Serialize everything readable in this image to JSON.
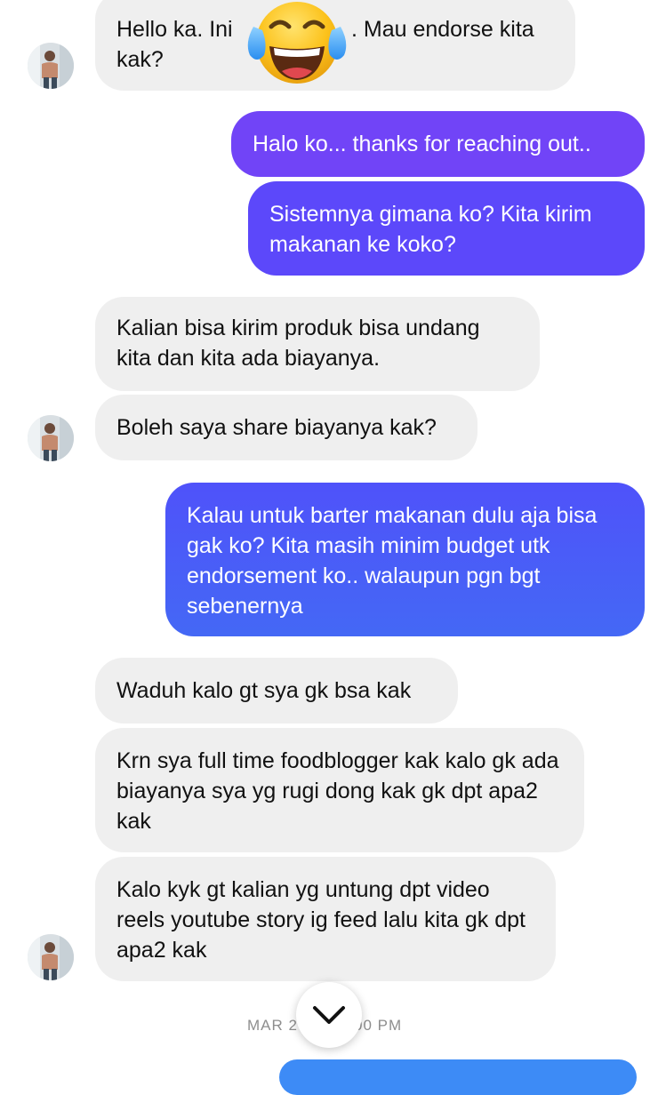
{
  "conversation": {
    "messages": [
      {
        "sender": "them",
        "text": "Hello ka. Ini  . Mau endorse kita kak?",
        "line1_left": "Hello ka. Ini ",
        "line1_right": ". Mau endorse kita",
        "line2": "kak?"
      },
      {
        "sender": "me",
        "text": "Halo ko... thanks for reaching out.."
      },
      {
        "sender": "me",
        "text": "Sistemnya gimana ko? Kita kirim makanan ke koko?"
      },
      {
        "sender": "them",
        "text": "Kalian bisa kirim produk bisa undang kita dan kita ada biayanya."
      },
      {
        "sender": "them",
        "text": "Boleh saya share biayanya kak?"
      },
      {
        "sender": "me",
        "text": "Kalau untuk barter makanan dulu aja bisa gak ko? Kita masih minim budget utk endorsement ko.. walaupun pgn bgt sebenernya"
      },
      {
        "sender": "them",
        "text": "Waduh kalo gt sya gk bsa kak"
      },
      {
        "sender": "them",
        "text": "Krn sya full time foodblogger kak kalo gk ada biayanya sya yg rugi dong kak gk dpt apa2 kak"
      },
      {
        "sender": "them",
        "text": "Kalo kyk gt kalian yg untung dpt video reels youtube story ig feed lalu kita gk dpt apa2 kak"
      }
    ],
    "timestamp": {
      "left": "MAR 2",
      "right": "00 PM"
    }
  },
  "overlay": {
    "emoji": "face-with-tears-of-joy",
    "scroll_button_icon": "chevron-down-icon"
  },
  "colors": {
    "incoming_bubble": "#efefef",
    "outgoing_gradient_top": "#7a45f5",
    "outgoing_gradient_mid": "#5a4bfa",
    "outgoing_gradient_bottom": "#4468f5",
    "bottom_bubble": "#3d8bf6",
    "timestamp": "#8e8e8e"
  }
}
